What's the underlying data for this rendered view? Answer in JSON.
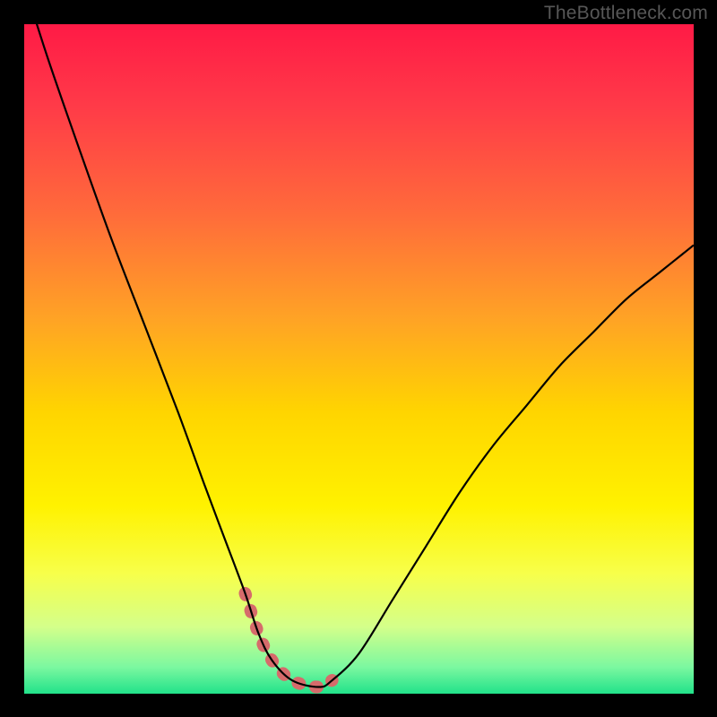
{
  "watermark": "TheBottleneck.com",
  "chart_data": {
    "type": "line",
    "title": "",
    "xlabel": "",
    "ylabel": "",
    "xlim": [
      0,
      100
    ],
    "ylim": [
      0,
      100
    ],
    "series": [
      {
        "name": "bottleneck-curve",
        "x": [
          0,
          3.5,
          8,
          13,
          18,
          23,
          27,
          30,
          33,
          35,
          37,
          40,
          44,
          46,
          50,
          55,
          60,
          65,
          70,
          75,
          80,
          85,
          90,
          95,
          100
        ],
        "y": [
          106,
          95,
          82,
          68,
          55,
          42,
          31,
          23,
          15,
          9,
          5,
          2,
          1,
          2,
          6,
          14,
          22,
          30,
          37,
          43,
          49,
          54,
          59,
          63,
          67
        ]
      }
    ],
    "highlight": {
      "name": "near-zero-band",
      "x_range": [
        32,
        46
      ],
      "y_max": 15,
      "color": "#d66b6b"
    },
    "gradient_stops": [
      {
        "pos": 0.0,
        "color": "#ff1a46"
      },
      {
        "pos": 0.12,
        "color": "#ff3a48"
      },
      {
        "pos": 0.28,
        "color": "#ff6a3b"
      },
      {
        "pos": 0.44,
        "color": "#ffa325"
      },
      {
        "pos": 0.58,
        "color": "#ffd500"
      },
      {
        "pos": 0.72,
        "color": "#fff200"
      },
      {
        "pos": 0.82,
        "color": "#f7ff4a"
      },
      {
        "pos": 0.9,
        "color": "#d4ff8a"
      },
      {
        "pos": 0.96,
        "color": "#7cf8a0"
      },
      {
        "pos": 1.0,
        "color": "#21e28a"
      }
    ]
  }
}
